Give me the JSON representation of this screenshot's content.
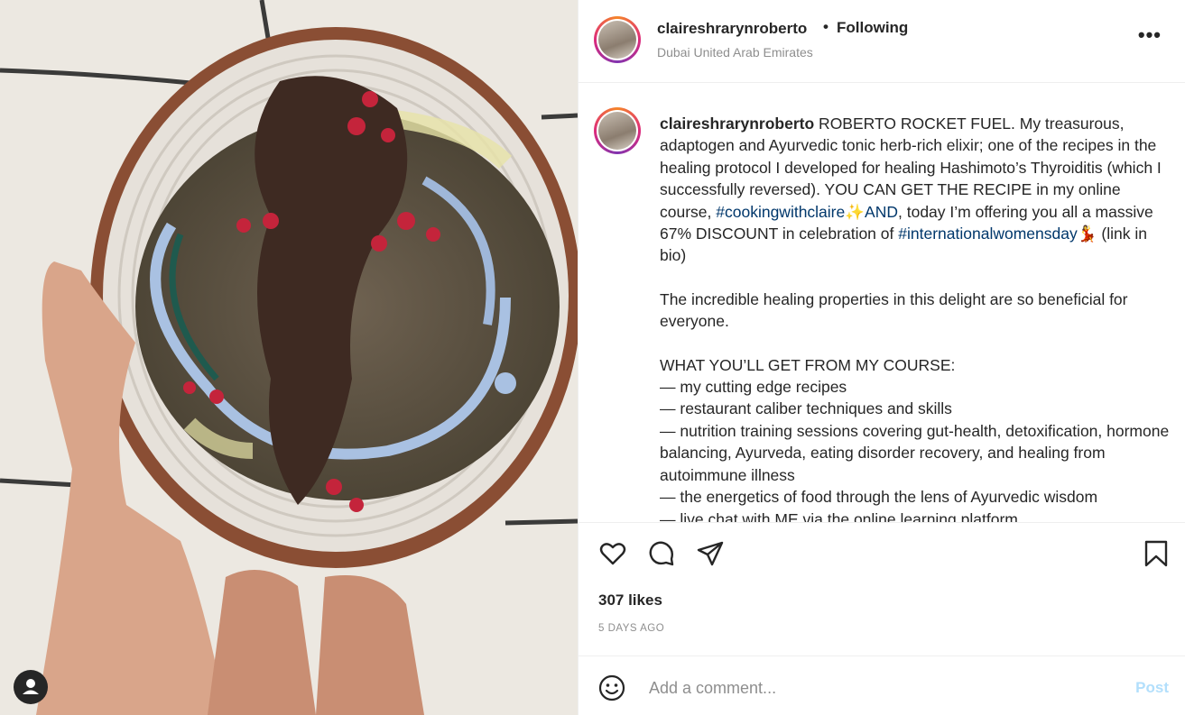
{
  "post": {
    "username": "claireshrarynroberto",
    "follow_status": "Following",
    "location": "Dubai United Arab Emirates",
    "more_label": "•••"
  },
  "caption": {
    "username": "claireshrarynroberto",
    "line1_a": " ROBERTO ROCKET FUEL. My treasurous, adaptogen and Ayurvedic tonic herb-rich elixir; one of the recipes in the healing protocol I developed for healing Hashimoto’s Thyroiditis (which I successfully reversed). YOU CAN GET THE RECIPE in my online course, ",
    "hashtag1": "#cookingwithclaire",
    "emoji1": "✨",
    "and": "AND",
    "line1_b": ", today I’m offering you all a massive 67% DISCOUNT in celebration of ",
    "hashtag2": "#internationalwomensday",
    "emoji2": "💃",
    "line1_c": " (link in bio)",
    "para2": "The incredible healing properties in this delight are so beneficial for everyone.",
    "heading": "WHAT YOU’LL GET FROM MY COURSE:",
    "items": [
      "— my cutting edge recipes",
      "— restaurant caliber techniques and skills",
      "— nutrition training sessions covering gut-health, detoxification, hormone balancing, Ayurveda, eating disorder recovery, and healing from autoimmune illness",
      "— the energetics of food through the lens of Ayurvedic wisdom",
      "— live chat with ME via the online learning platform"
    ]
  },
  "actions": {
    "likes": "307 likes",
    "time_ago": "5 DAYS AGO"
  },
  "comment": {
    "placeholder": "Add a comment...",
    "post_label": "Post"
  },
  "icons": [
    "heart-icon",
    "comment-icon",
    "share-icon",
    "bookmark-icon",
    "emoji-icon",
    "more-icon",
    "user-icon"
  ],
  "colors": {
    "link": "#00376b",
    "post_button": "#b2dffc",
    "muted": "#8e8e8e"
  }
}
